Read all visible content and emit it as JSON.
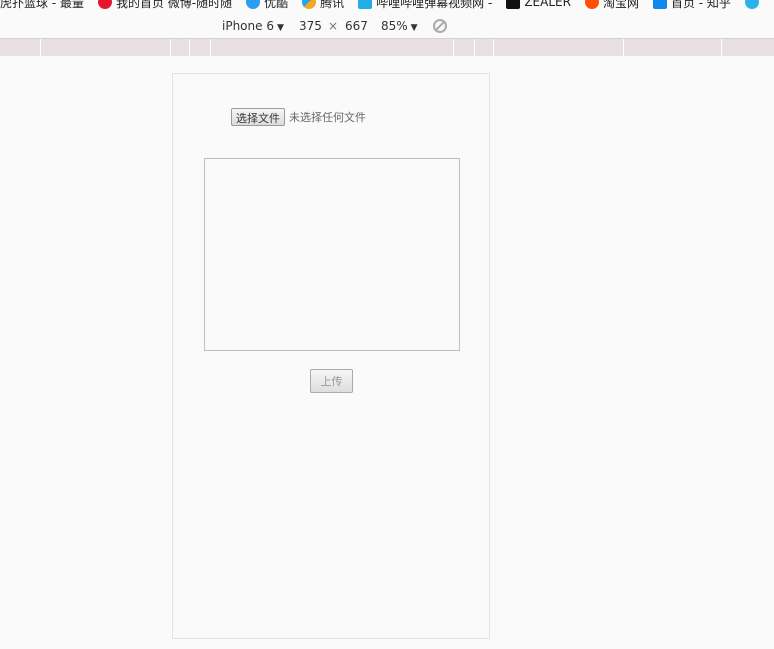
{
  "bookmarks": [
    {
      "label": "虎扑篮球 - 最量",
      "icon": "none"
    },
    {
      "label": "我的首页 微博-随时随",
      "icon": "weibo-icon"
    },
    {
      "label": "优酷",
      "icon": "youku-icon"
    },
    {
      "label": "腾讯",
      "icon": "tencent-icon"
    },
    {
      "label": "哔哩哔哩弹幕视频网 -",
      "icon": "bilibili-icon"
    },
    {
      "label": "ZEALER",
      "icon": "zealer-icon"
    },
    {
      "label": "淘宝网",
      "icon": "taobao-icon"
    },
    {
      "label": "首页 - 知乎",
      "icon": "zhihu-icon"
    }
  ],
  "device_toolbar": {
    "device": "iPhone 6",
    "width": "375",
    "times": "×",
    "height": "667",
    "zoom": "85%"
  },
  "page": {
    "choose_file_label": "选择文件",
    "no_file_text": "未选择任何文件",
    "textarea_value": "",
    "upload_label": "上传"
  }
}
